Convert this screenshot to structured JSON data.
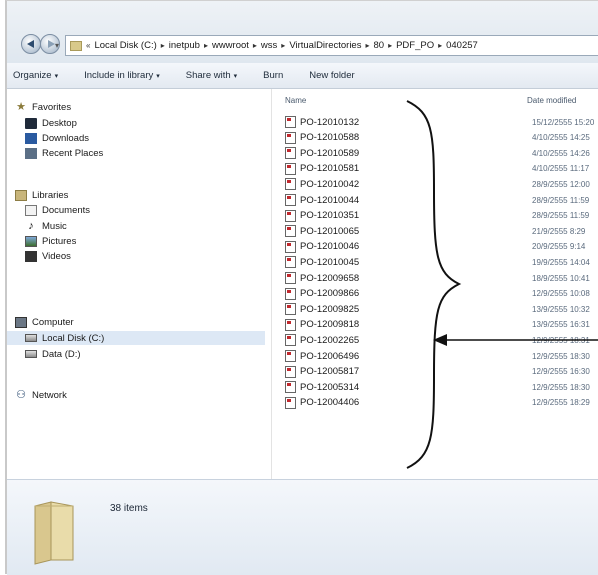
{
  "address_bar": {
    "crumbs": [
      "Local Disk (C:)",
      "inetpub",
      "wwwroot",
      "wss",
      "VirtualDirectories",
      "80",
      "PDF_PO",
      "040257"
    ]
  },
  "toolbar": {
    "organize": "Organize",
    "include": "Include in library",
    "share": "Share with",
    "burn": "Burn",
    "new_folder": "New folder"
  },
  "nav": {
    "favorites": "Favorites",
    "desktop": "Desktop",
    "downloads": "Downloads",
    "recent": "Recent Places",
    "libraries": "Libraries",
    "documents": "Documents",
    "music": "Music",
    "pictures": "Pictures",
    "videos": "Videos",
    "computer": "Computer",
    "local_disk": "Local Disk (C:)",
    "data": "Data (D:)",
    "network": "Network"
  },
  "columns": {
    "name": "Name",
    "date": "Date modified"
  },
  "files": [
    {
      "name": "PO-12010132",
      "date": "15/12/2555 15:20"
    },
    {
      "name": "PO-12010588",
      "date": "4/10/2555 14:25"
    },
    {
      "name": "PO-12010589",
      "date": "4/10/2555 14:26"
    },
    {
      "name": "PO-12010581",
      "date": "4/10/2555 11:17"
    },
    {
      "name": "PO-12010042",
      "date": "28/9/2555 12:00"
    },
    {
      "name": "PO-12010044",
      "date": "28/9/2555 11:59"
    },
    {
      "name": "PO-12010351",
      "date": "28/9/2555 11:59"
    },
    {
      "name": "PO-12010065",
      "date": "21/9/2555 8:29"
    },
    {
      "name": "PO-12010046",
      "date": "20/9/2555 9:14"
    },
    {
      "name": "PO-12010045",
      "date": "19/9/2555 14:04"
    },
    {
      "name": "PO-12009658",
      "date": "18/9/2555 10:41"
    },
    {
      "name": "PO-12009866",
      "date": "12/9/2555 10:08"
    },
    {
      "name": "PO-12009825",
      "date": "13/9/2555 10:32"
    },
    {
      "name": "PO-12009818",
      "date": "13/9/2555 16:31"
    },
    {
      "name": "PO-12002265",
      "date": "12/9/2555 18:31"
    },
    {
      "name": "PO-12006496",
      "date": "12/9/2555 18:30"
    },
    {
      "name": "PO-12005817",
      "date": "12/9/2555 16:30"
    },
    {
      "name": "PO-12005314",
      "date": "12/9/2555 18:30"
    },
    {
      "name": "PO-12004406",
      "date": "12/9/2555 18:29"
    }
  ],
  "details": {
    "count": "38 items"
  }
}
